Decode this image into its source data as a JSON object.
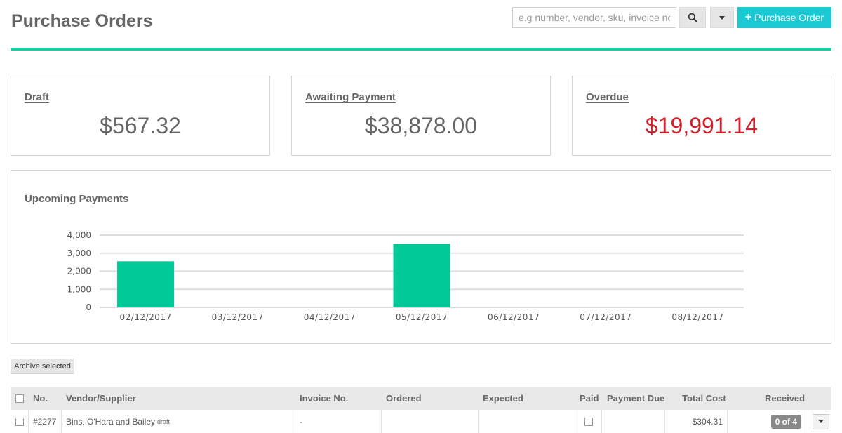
{
  "header": {
    "title": "Purchase Orders",
    "search_placeholder": "e.g number, vendor, sku, invoice no",
    "search_icon": "search-icon",
    "filter_icon": "caret-down-icon",
    "new_button_icon": "+",
    "new_button_label": "Purchase Order",
    "accent_color": "#20c9a8",
    "button_color": "#1cc9d2"
  },
  "summary_cards": [
    {
      "label": "Draft",
      "value": "$567.32",
      "value_color": "#666666"
    },
    {
      "label": "Awaiting Payment",
      "value": "$38,878.00",
      "value_color": "#666666"
    },
    {
      "label": "Overdue",
      "value": "$19,991.14",
      "value_color": "#d0202b"
    }
  ],
  "chart_panel": {
    "title": "Upcoming Payments"
  },
  "chart_data": {
    "type": "bar",
    "title": "Upcoming Payments",
    "categories": [
      "02/12/2017",
      "03/12/2017",
      "04/12/2017",
      "05/12/2017",
      "06/12/2017",
      "07/12/2017",
      "08/12/2017"
    ],
    "values": [
      2550,
      0,
      0,
      3520,
      0,
      0,
      0
    ],
    "ylim": [
      0,
      4000
    ],
    "yticks": [
      "0",
      "1,000",
      "2,000",
      "3,000",
      "4,000"
    ],
    "grid": true,
    "bar_color": "#00c896"
  },
  "archive_button": "Archive selected",
  "table": {
    "headers": {
      "no": "No.",
      "vendor": "Vendor/Supplier",
      "invoice": "Invoice No.",
      "ordered": "Ordered",
      "expected": "Expected",
      "paid": "Paid",
      "payment_due": "Payment Due",
      "total_cost": "Total Cost",
      "received": "Received"
    },
    "rows": [
      {
        "no": "#2277",
        "vendor": "Bins, O'Hara and Bailey",
        "status": "draft",
        "invoice": "-",
        "ordered": "",
        "expected": "",
        "payment_due": "",
        "total_cost": "$304.31",
        "received": "0 of 4"
      }
    ]
  }
}
